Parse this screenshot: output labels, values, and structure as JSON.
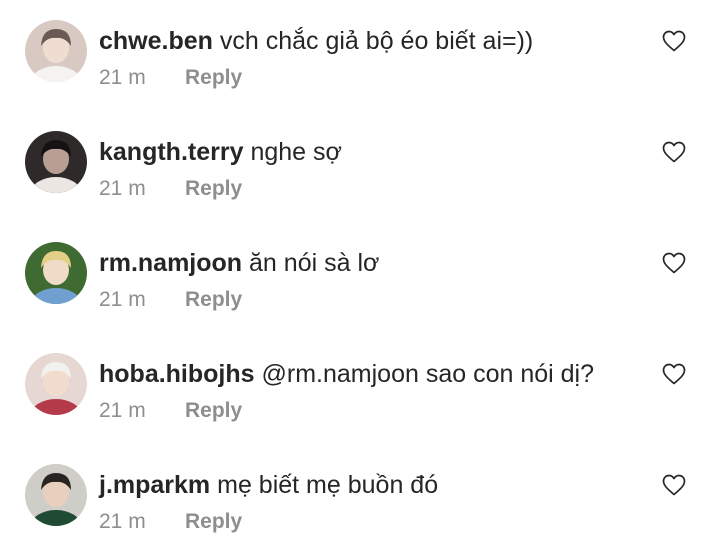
{
  "comments": [
    {
      "username": "chwe.ben",
      "text": "vch chắc giả bộ éo biết ai=))",
      "time": "21 m",
      "reply_label": "Reply",
      "avatar": {
        "bg": "#d8c9c3",
        "hair": "#6a5a55",
        "skin": "#f0ddd2",
        "shirt": "#f5f2f0"
      }
    },
    {
      "username": "kangth.terry",
      "text": "nghe sợ",
      "time": "21 m",
      "reply_label": "Reply",
      "avatar": {
        "bg": "#2e2a2a",
        "hair": "#141212",
        "skin": "#b99f93",
        "shirt": "#ece6e2"
      }
    },
    {
      "username": "rm.namjoon",
      "text": "ăn nói sà lơ",
      "time": "21 m",
      "reply_label": "Reply",
      "avatar": {
        "bg": "#3f6b33",
        "hair": "#e4cf86",
        "skin": "#f0dac8",
        "shirt": "#6fa0cf"
      }
    },
    {
      "username": "hoba.hibojhs",
      "text": "@rm.namjoon sao con nói dị?",
      "time": "21 m",
      "reply_label": "Reply",
      "avatar": {
        "bg": "#e6d7d2",
        "hair": "#f1f1ef",
        "skin": "#f1dccd",
        "shirt": "#b53b4b"
      }
    },
    {
      "username": "j.mparkm",
      "text": "mẹ biết mẹ buồn đó",
      "time": "21 m",
      "reply_label": "Reply",
      "avatar": {
        "bg": "#cfcdc8",
        "hair": "#272422",
        "skin": "#e8d0bf",
        "shirt": "#1f4a34"
      }
    }
  ]
}
